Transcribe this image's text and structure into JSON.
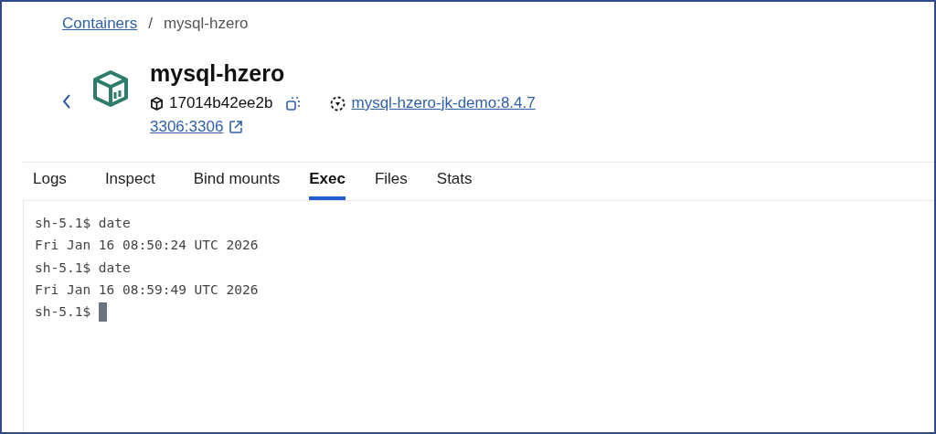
{
  "breadcrumb": {
    "link": "Containers",
    "separator": "/",
    "current": "mysql-hzero"
  },
  "container": {
    "name": "mysql-hzero",
    "id": "17014b42ee2b",
    "image": "mysql-hzero-jk-demo:8.4.7",
    "port": "3306:3306"
  },
  "tabs": [
    {
      "label": "Logs",
      "selected": false
    },
    {
      "label": "Inspect",
      "selected": false
    },
    {
      "label": "Bind mounts",
      "selected": false
    },
    {
      "label": "Exec",
      "selected": true
    },
    {
      "label": "Files",
      "selected": false
    },
    {
      "label": "Stats",
      "selected": false
    }
  ],
  "terminal": {
    "lines": [
      "sh-5.1$ date",
      "Fri Jan 16 08:50:24 UTC 2026",
      "sh-5.1$ date",
      "Fri Jan 16 08:59:49 UTC 2026"
    ],
    "prompt": "sh-5.1$"
  }
}
